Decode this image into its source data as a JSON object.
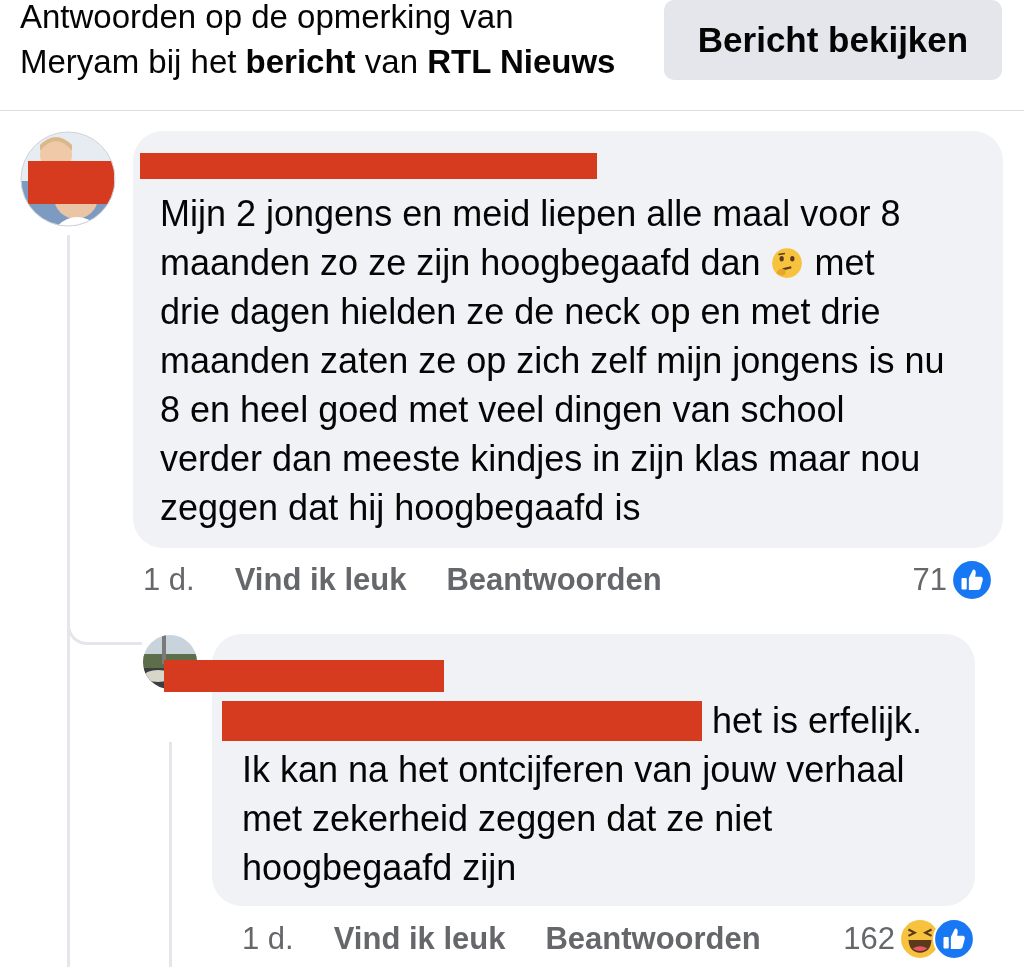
{
  "header": {
    "text": "Antwoorden op de opmerking van Meryam bij het **bericht** van **RTL Nieuws**",
    "button": "Bericht bekijken"
  },
  "comment": {
    "redacted_name": true,
    "lines": [
      [
        {
          "kind": "text",
          "text": "Mijn 2 jongens en meid liepen alle maal voor 8"
        }
      ],
      [
        {
          "kind": "text",
          "text": "maanden zo ze zijn hoogbegaafd dan"
        },
        {
          "kind": "thinking-emoji"
        },
        {
          "kind": "text",
          "text": "met"
        }
      ],
      [
        {
          "kind": "text",
          "text": "drie dagen hielden ze de neck op en met drie"
        }
      ],
      [
        {
          "kind": "text",
          "text": "maanden zaten ze op zich zelf mijn jongens is nu"
        }
      ],
      [
        {
          "kind": "text",
          "text": "8 en heel goed met veel dingen van school"
        }
      ],
      [
        {
          "kind": "text",
          "text": "verder dan meeste kindjes in zijn klas maar nou"
        }
      ],
      [
        {
          "kind": "text",
          "text": "zeggen dat hij hoogbegaafd is"
        }
      ]
    ],
    "time": "1 d.",
    "like": "Vind ik leuk",
    "reply": "Beantwoorden",
    "count": "71",
    "reactions": [
      {
        "kind": "like"
      }
    ]
  },
  "reply": {
    "redacted_name": true,
    "lines": [
      [
        {
          "kind": "redacted"
        },
        {
          "kind": "text",
          "text": "het is erfelijk."
        }
      ],
      [
        {
          "kind": "text",
          "text": "Ik kan na het ontcijferen van jouw verhaal"
        }
      ],
      [
        {
          "kind": "text",
          "text": "met zekerheid zeggen dat ze niet"
        }
      ],
      [
        {
          "kind": "text",
          "text": "hoogbegaafd zijn"
        }
      ]
    ],
    "time": "1 d.",
    "like": "Vind ik leuk",
    "reply": "Beantwoorden",
    "count": "162",
    "reactions": [
      {
        "kind": "haha"
      },
      {
        "kind": "like"
      }
    ]
  }
}
